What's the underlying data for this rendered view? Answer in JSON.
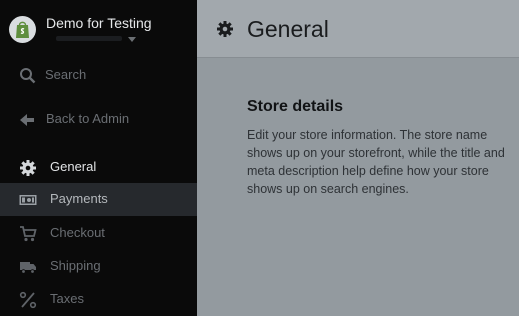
{
  "sidebar": {
    "store_name": "Demo for Testing",
    "items": [
      {
        "label": "Search",
        "icon": "search-icon"
      },
      {
        "label": "Back to Admin",
        "icon": "back-arrow-icon"
      },
      {
        "label": "General",
        "icon": "gear-icon"
      },
      {
        "label": "Payments",
        "icon": "payments-icon"
      },
      {
        "label": "Checkout",
        "icon": "cart-icon"
      },
      {
        "label": "Shipping",
        "icon": "truck-icon"
      },
      {
        "label": "Taxes",
        "icon": "percent-icon"
      }
    ]
  },
  "main": {
    "title": "General",
    "section": {
      "title": "Store details",
      "description": "Edit your store information. The store name shows up on your storefront, while the title and meta description help define how your store shows up on search engines."
    }
  },
  "colors": {
    "sidebar_bg": "#0a0a0a",
    "active_row_bg": "#26292d",
    "main_bg": "#939a9f",
    "topbar_bg": "#a2a8ad"
  }
}
